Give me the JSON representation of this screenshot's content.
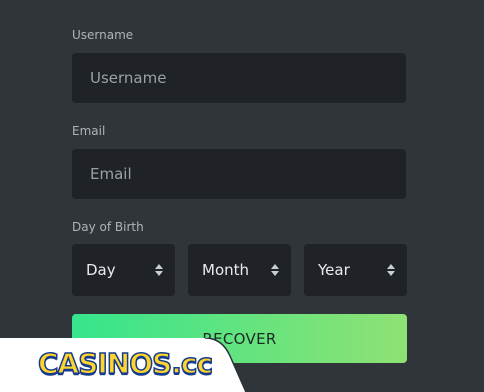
{
  "form": {
    "username": {
      "label": "Username",
      "placeholder": "Username"
    },
    "email": {
      "label": "Email",
      "placeholder": "Email"
    },
    "dob": {
      "label": "Day of Birth",
      "day": "Day",
      "month": "Month",
      "year": "Year"
    },
    "recover_label": "RECOVER"
  },
  "watermark": {
    "text": "CASINOS.cc"
  },
  "colors": {
    "background": "#2f3539",
    "field": "#1f2327",
    "accent_start": "#35e58c",
    "accent_end": "#8fe273"
  }
}
